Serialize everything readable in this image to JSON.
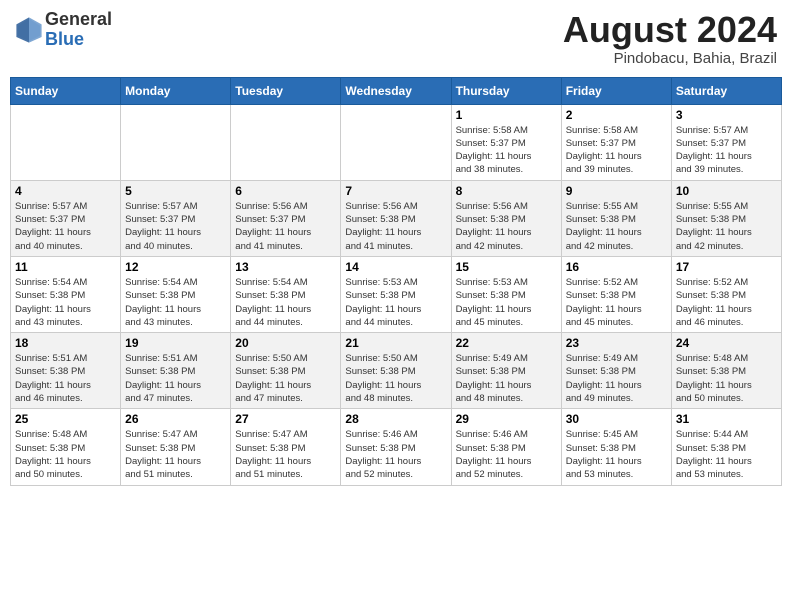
{
  "header": {
    "logo_general": "General",
    "logo_blue": "Blue",
    "month_title": "August 2024",
    "location": "Pindobacu, Bahia, Brazil"
  },
  "days_of_week": [
    "Sunday",
    "Monday",
    "Tuesday",
    "Wednesday",
    "Thursday",
    "Friday",
    "Saturday"
  ],
  "weeks": [
    [
      {
        "day": "",
        "info": ""
      },
      {
        "day": "",
        "info": ""
      },
      {
        "day": "",
        "info": ""
      },
      {
        "day": "",
        "info": ""
      },
      {
        "day": "1",
        "info": "Sunrise: 5:58 AM\nSunset: 5:37 PM\nDaylight: 11 hours\nand 38 minutes."
      },
      {
        "day": "2",
        "info": "Sunrise: 5:58 AM\nSunset: 5:37 PM\nDaylight: 11 hours\nand 39 minutes."
      },
      {
        "day": "3",
        "info": "Sunrise: 5:57 AM\nSunset: 5:37 PM\nDaylight: 11 hours\nand 39 minutes."
      }
    ],
    [
      {
        "day": "4",
        "info": "Sunrise: 5:57 AM\nSunset: 5:37 PM\nDaylight: 11 hours\nand 40 minutes."
      },
      {
        "day": "5",
        "info": "Sunrise: 5:57 AM\nSunset: 5:37 PM\nDaylight: 11 hours\nand 40 minutes."
      },
      {
        "day": "6",
        "info": "Sunrise: 5:56 AM\nSunset: 5:37 PM\nDaylight: 11 hours\nand 41 minutes."
      },
      {
        "day": "7",
        "info": "Sunrise: 5:56 AM\nSunset: 5:38 PM\nDaylight: 11 hours\nand 41 minutes."
      },
      {
        "day": "8",
        "info": "Sunrise: 5:56 AM\nSunset: 5:38 PM\nDaylight: 11 hours\nand 42 minutes."
      },
      {
        "day": "9",
        "info": "Sunrise: 5:55 AM\nSunset: 5:38 PM\nDaylight: 11 hours\nand 42 minutes."
      },
      {
        "day": "10",
        "info": "Sunrise: 5:55 AM\nSunset: 5:38 PM\nDaylight: 11 hours\nand 42 minutes."
      }
    ],
    [
      {
        "day": "11",
        "info": "Sunrise: 5:54 AM\nSunset: 5:38 PM\nDaylight: 11 hours\nand 43 minutes."
      },
      {
        "day": "12",
        "info": "Sunrise: 5:54 AM\nSunset: 5:38 PM\nDaylight: 11 hours\nand 43 minutes."
      },
      {
        "day": "13",
        "info": "Sunrise: 5:54 AM\nSunset: 5:38 PM\nDaylight: 11 hours\nand 44 minutes."
      },
      {
        "day": "14",
        "info": "Sunrise: 5:53 AM\nSunset: 5:38 PM\nDaylight: 11 hours\nand 44 minutes."
      },
      {
        "day": "15",
        "info": "Sunrise: 5:53 AM\nSunset: 5:38 PM\nDaylight: 11 hours\nand 45 minutes."
      },
      {
        "day": "16",
        "info": "Sunrise: 5:52 AM\nSunset: 5:38 PM\nDaylight: 11 hours\nand 45 minutes."
      },
      {
        "day": "17",
        "info": "Sunrise: 5:52 AM\nSunset: 5:38 PM\nDaylight: 11 hours\nand 46 minutes."
      }
    ],
    [
      {
        "day": "18",
        "info": "Sunrise: 5:51 AM\nSunset: 5:38 PM\nDaylight: 11 hours\nand 46 minutes."
      },
      {
        "day": "19",
        "info": "Sunrise: 5:51 AM\nSunset: 5:38 PM\nDaylight: 11 hours\nand 47 minutes."
      },
      {
        "day": "20",
        "info": "Sunrise: 5:50 AM\nSunset: 5:38 PM\nDaylight: 11 hours\nand 47 minutes."
      },
      {
        "day": "21",
        "info": "Sunrise: 5:50 AM\nSunset: 5:38 PM\nDaylight: 11 hours\nand 48 minutes."
      },
      {
        "day": "22",
        "info": "Sunrise: 5:49 AM\nSunset: 5:38 PM\nDaylight: 11 hours\nand 48 minutes."
      },
      {
        "day": "23",
        "info": "Sunrise: 5:49 AM\nSunset: 5:38 PM\nDaylight: 11 hours\nand 49 minutes."
      },
      {
        "day": "24",
        "info": "Sunrise: 5:48 AM\nSunset: 5:38 PM\nDaylight: 11 hours\nand 50 minutes."
      }
    ],
    [
      {
        "day": "25",
        "info": "Sunrise: 5:48 AM\nSunset: 5:38 PM\nDaylight: 11 hours\nand 50 minutes."
      },
      {
        "day": "26",
        "info": "Sunrise: 5:47 AM\nSunset: 5:38 PM\nDaylight: 11 hours\nand 51 minutes."
      },
      {
        "day": "27",
        "info": "Sunrise: 5:47 AM\nSunset: 5:38 PM\nDaylight: 11 hours\nand 51 minutes."
      },
      {
        "day": "28",
        "info": "Sunrise: 5:46 AM\nSunset: 5:38 PM\nDaylight: 11 hours\nand 52 minutes."
      },
      {
        "day": "29",
        "info": "Sunrise: 5:46 AM\nSunset: 5:38 PM\nDaylight: 11 hours\nand 52 minutes."
      },
      {
        "day": "30",
        "info": "Sunrise: 5:45 AM\nSunset: 5:38 PM\nDaylight: 11 hours\nand 53 minutes."
      },
      {
        "day": "31",
        "info": "Sunrise: 5:44 AM\nSunset: 5:38 PM\nDaylight: 11 hours\nand 53 minutes."
      }
    ]
  ]
}
